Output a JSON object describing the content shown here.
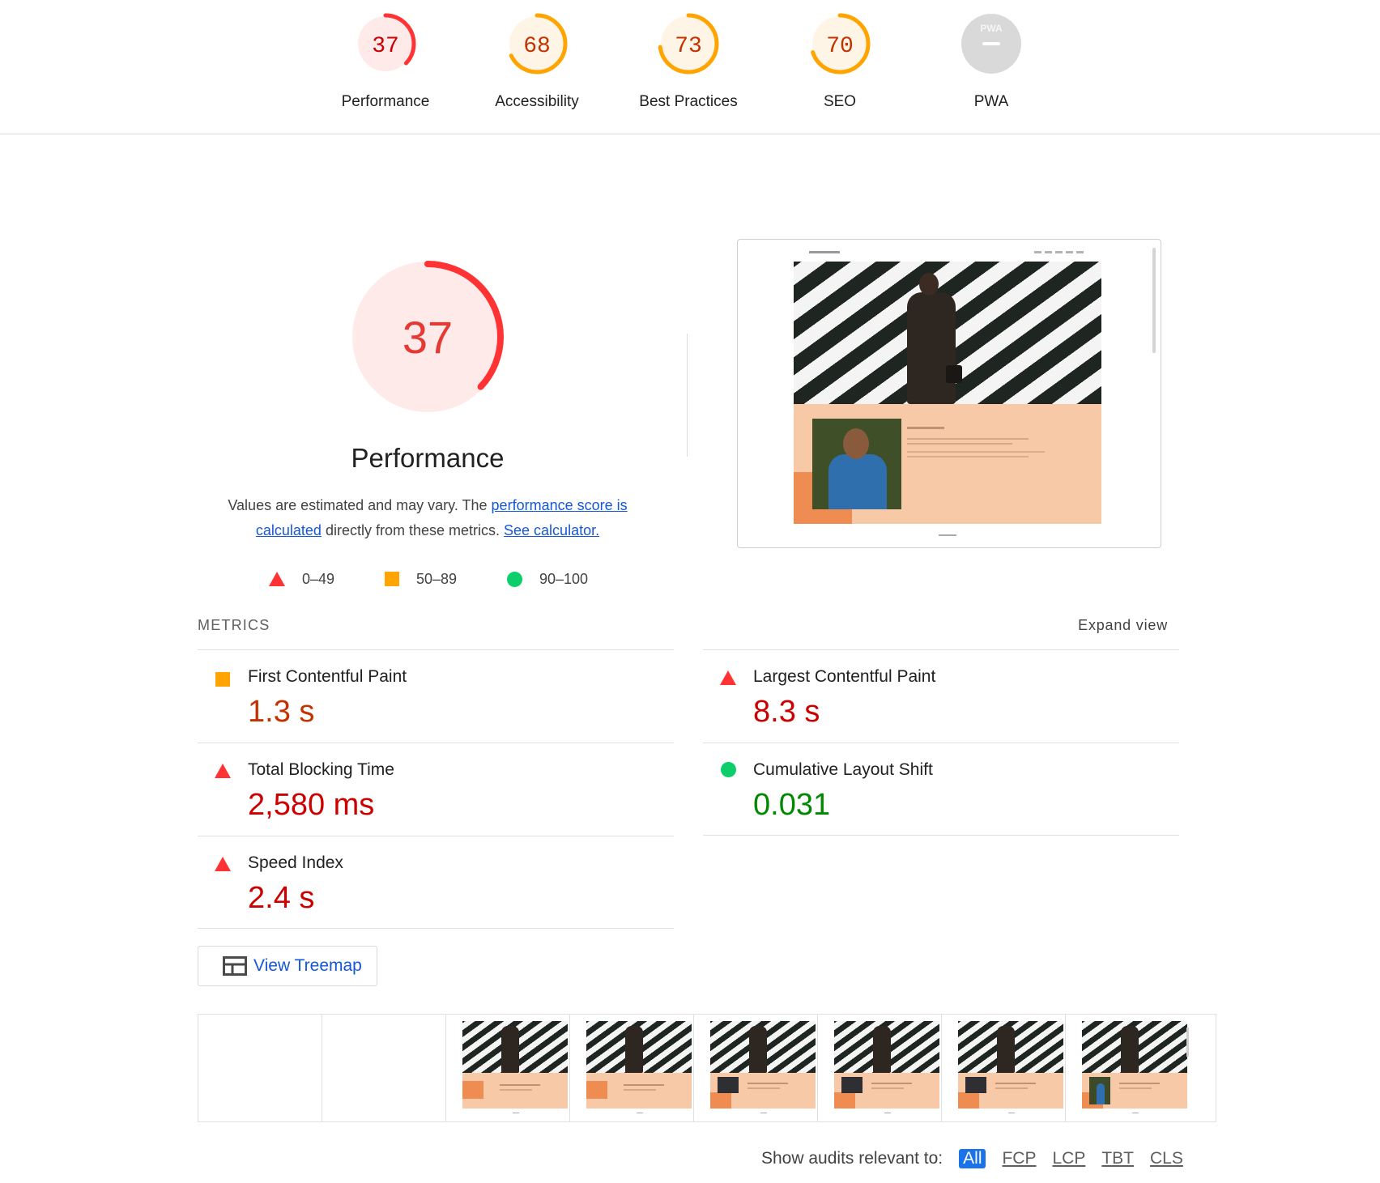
{
  "colors": {
    "fail": "#ff3333",
    "average": "#ffa400",
    "pass": "#0cce6b",
    "fail_text": "#cc0000",
    "average_text": "#c33300",
    "pass_text": "#008800",
    "link": "#1558d6",
    "pwa_gray": "#d9d9d9"
  },
  "categories": [
    {
      "label": "Performance",
      "score": "37",
      "score_value": 37,
      "rating": "fail"
    },
    {
      "label": "Accessibility",
      "score": "68",
      "score_value": 68,
      "rating": "average"
    },
    {
      "label": "Best Practices",
      "score": "73",
      "score_value": 73,
      "rating": "average"
    },
    {
      "label": "SEO",
      "score": "70",
      "score_value": 70,
      "rating": "average"
    },
    {
      "label": "PWA",
      "badge": "PWA",
      "icon": "pwa-dash-icon",
      "rating": "not-applicable"
    }
  ],
  "hero": {
    "score": "37",
    "score_value": 37,
    "title": "Performance",
    "desc_prefix": "Values are estimated and may vary. The ",
    "desc_link": "performance score is calculated",
    "desc_middle": " directly from these metrics. ",
    "desc_calc_link": "See calculator."
  },
  "legend": [
    {
      "range": "0–49",
      "icon": "triangle-icon"
    },
    {
      "range": "50–89",
      "icon": "square-icon"
    },
    {
      "range": "90–100",
      "icon": "circle-icon"
    }
  ],
  "metrics": {
    "label": "METRICS",
    "expand_label": "Expand view",
    "items": [
      {
        "title": "First Contentful Paint",
        "value": "1.3 s",
        "rating": "average"
      },
      {
        "title": "Largest Contentful Paint",
        "value": "8.3 s",
        "rating": "fail"
      },
      {
        "title": "Total Blocking Time",
        "value": "2,580 ms",
        "rating": "fail"
      },
      {
        "title": "Cumulative Layout Shift",
        "value": "0.031",
        "rating": "pass"
      },
      {
        "title": "Speed Index",
        "value": "2.4 s",
        "rating": "fail"
      }
    ]
  },
  "treemap": {
    "label": "View Treemap",
    "icon": "treemap-icon"
  },
  "filmstrip": {
    "frame_count": 8
  },
  "audit_filter": {
    "label": "Show audits relevant to:",
    "options": [
      "All",
      "FCP",
      "LCP",
      "TBT",
      "CLS"
    ],
    "active": "All"
  }
}
